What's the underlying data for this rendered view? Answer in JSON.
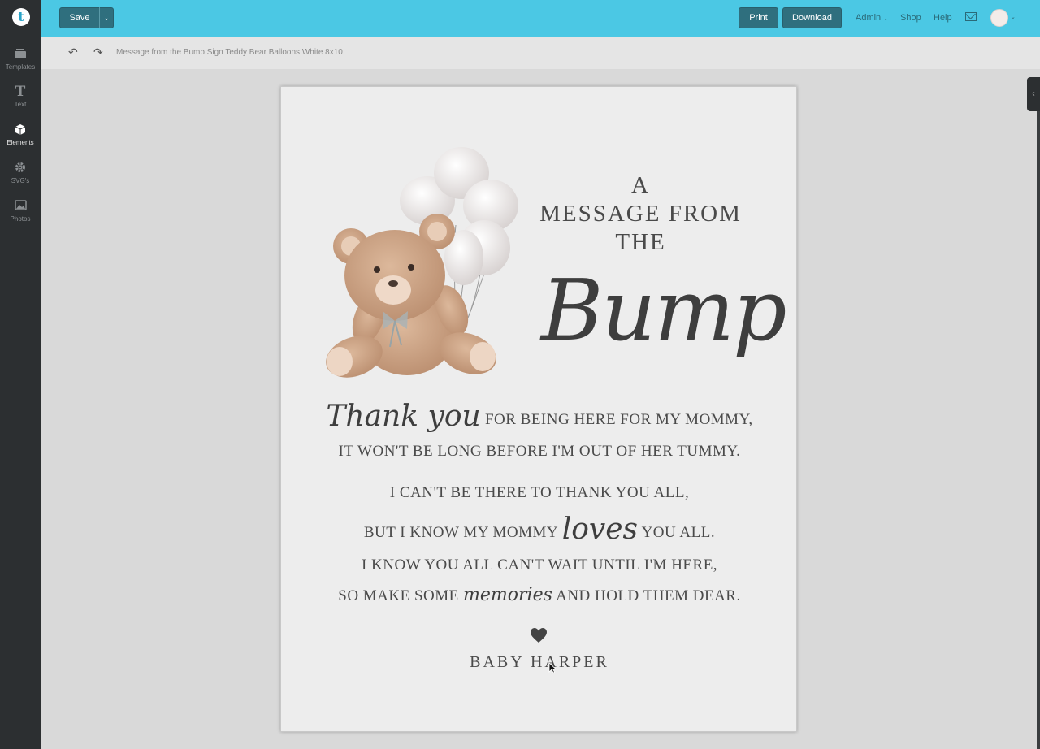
{
  "app": {
    "logo_letter": "t"
  },
  "sidebar": {
    "items": [
      {
        "label": "Templates",
        "icon": "templates-icon",
        "active": false
      },
      {
        "label": "Text",
        "icon": "text-icon",
        "active": false
      },
      {
        "label": "Elements",
        "icon": "elements-icon",
        "active": true
      },
      {
        "label": "SVG's",
        "icon": "gear-icon",
        "active": false
      },
      {
        "label": "Photos",
        "icon": "photo-icon",
        "active": false
      }
    ]
  },
  "topbar": {
    "save_label": "Save",
    "print_label": "Print",
    "download_label": "Download",
    "admin_label": "Admin",
    "shop_label": "Shop",
    "help_label": "Help"
  },
  "toolbar": {
    "document_title": "Message from the Bump Sign Teddy Bear Balloons White 8x10"
  },
  "design": {
    "heading_line1": "A",
    "heading_line2": "MESSAGE FROM",
    "heading_line3": "THE",
    "heading_script": "Bump",
    "verse1_script": "Thank you",
    "verse1_line1": "FOR BEING HERE FOR MY MOMMY,",
    "verse1_line2": "IT WON'T BE LONG BEFORE I'M OUT OF HER TUMMY.",
    "verse2_line1": "I CAN'T BE THERE TO THANK YOU ALL,",
    "verse2_line2_a": "BUT I KNOW MY MOMMY",
    "verse2_script": "loves",
    "verse2_line2_b": "YOU ALL.",
    "verse3_line1": "I KNOW YOU ALL CAN'T WAIT UNTIL I'M HERE,",
    "verse3_line2_a": "SO MAKE SOME",
    "verse3_script": "memories",
    "verse3_line2_b": "AND HOLD THEM DEAR.",
    "signature": "BABY HARPER"
  },
  "colors": {
    "topbar": "#4bc8e4",
    "button": "#2f6f7e",
    "sidebar": "#2c2f31",
    "canvas": "#ededed",
    "text": "#4a4a4a",
    "bear": "#caa283"
  }
}
